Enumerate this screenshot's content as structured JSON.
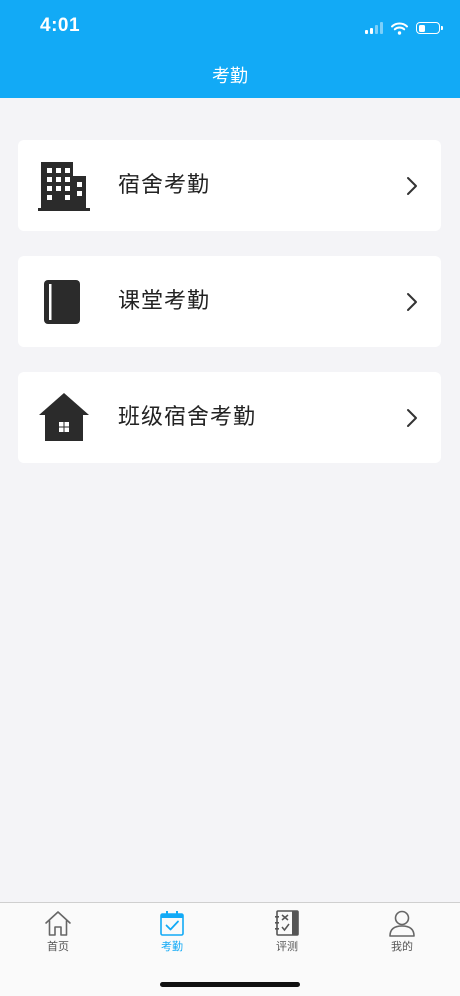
{
  "status_bar": {
    "time": "4:01",
    "battery_level": 0.35
  },
  "header": {
    "title": "考勤"
  },
  "menu": [
    {
      "label": "宿舍考勤",
      "icon": "building-icon"
    },
    {
      "label": "课堂考勤",
      "icon": "book-icon"
    },
    {
      "label": "班级宿舍考勤",
      "icon": "house-icon"
    }
  ],
  "tabbar": {
    "items": [
      {
        "label": "首页",
        "icon": "home-icon",
        "active": false
      },
      {
        "label": "考勤",
        "icon": "calendar-check-icon",
        "active": true
      },
      {
        "label": "评测",
        "icon": "notebook-icon",
        "active": false
      },
      {
        "label": "我的",
        "icon": "user-icon",
        "active": false
      }
    ]
  },
  "colors": {
    "accent": "#12aaf6",
    "background": "#f4f4f7",
    "icon_dark": "#2b2b2b"
  }
}
